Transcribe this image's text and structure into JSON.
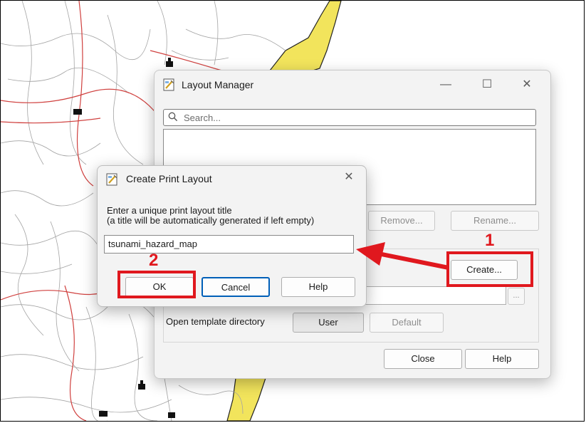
{
  "layout_manager": {
    "title": "Layout Manager",
    "icon": "qgis-layout-icon",
    "window_controls": {
      "minimize": "—",
      "maximize": "☐",
      "close": "✕"
    },
    "search_placeholder": "Search...",
    "remove_label": "Remove...",
    "rename_label": "Rename...",
    "create_label": "Create...",
    "template_browse_label": "...",
    "open_template_directory_label": "Open template directory",
    "user_label": "User",
    "default_label": "Default",
    "close_label": "Close",
    "help_label": "Help"
  },
  "create_print_layout": {
    "title": "Create Print Layout",
    "icon": "qgis-layout-icon",
    "close": "✕",
    "instruction_line1": "Enter a unique print layout title",
    "instruction_line2": "(a title will be automatically generated if left empty)",
    "title_value": "tsunami_hazard_map",
    "ok_label": "OK",
    "cancel_label": "Cancel",
    "help_label": "Help"
  },
  "annotations": {
    "step1": "1",
    "step2": "2",
    "color": "#e0181e"
  },
  "colors": {
    "map_background": "#ffffff",
    "map_roads_red": "#d0413f",
    "map_roads_grey": "#9a9a9a",
    "coast_yellow": "#f2e45c",
    "dialog_bg": "#f3f3f3"
  }
}
